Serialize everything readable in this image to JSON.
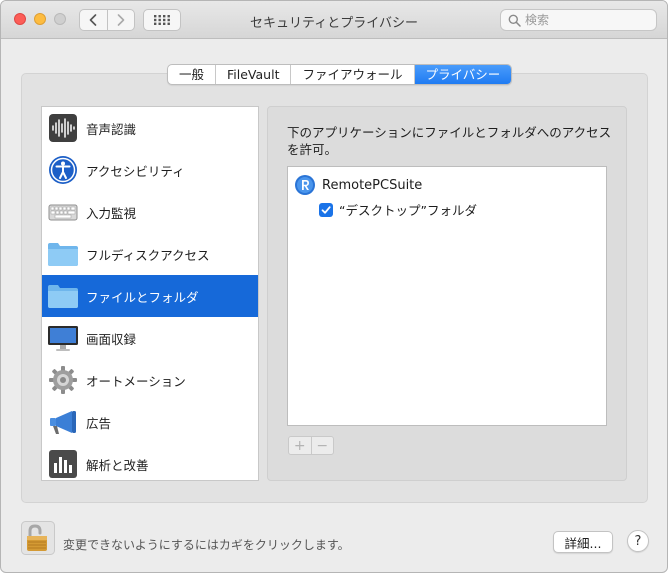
{
  "window": {
    "title": "セキュリティとプライバシー"
  },
  "toolbar": {
    "back_icon": "chevron-left-icon",
    "forward_icon": "chevron-right-icon",
    "grid_icon": "grid-icon"
  },
  "search": {
    "placeholder": "検索",
    "value": ""
  },
  "tabs": [
    {
      "label": "一般",
      "active": false
    },
    {
      "label": "FileVault",
      "active": false
    },
    {
      "label": "ファイアウォール",
      "active": false
    },
    {
      "label": "プライバシー",
      "active": true
    }
  ],
  "sidebar": {
    "items": [
      {
        "label": "音声認識",
        "icon": "speech-recognition-icon",
        "selected": false
      },
      {
        "label": "アクセシビリティ",
        "icon": "accessibility-icon",
        "selected": false
      },
      {
        "label": "入力監視",
        "icon": "keyboard-icon",
        "selected": false
      },
      {
        "label": "フルディスクアクセス",
        "icon": "folder-icon",
        "selected": false
      },
      {
        "label": "ファイルとフォルダ",
        "icon": "folder-icon",
        "selected": true
      },
      {
        "label": "画面収録",
        "icon": "display-icon",
        "selected": false
      },
      {
        "label": "オートメーション",
        "icon": "gear-icon",
        "selected": false
      },
      {
        "label": "広告",
        "icon": "megaphone-icon",
        "selected": false
      },
      {
        "label": "解析と改善",
        "icon": "bar-chart-icon",
        "selected": false
      }
    ]
  },
  "main": {
    "description": "下のアプリケーションにファイルとフォルダへのアクセスを許可。",
    "apps": [
      {
        "name": "RemotePCSuite",
        "icon": "remotepc-app-icon",
        "permissions": [
          {
            "label": "“デスクトップ”フォルダ",
            "checked": true
          }
        ]
      }
    ],
    "add_label": "+",
    "remove_label": "−"
  },
  "footer": {
    "lock_text": "変更できないようにするにはカギをクリックします。",
    "lock_icon": "unlocked-padlock-icon",
    "details_label": "詳細...",
    "help_label": "?"
  },
  "colors": {
    "accent": "#1669d9",
    "tab_active": "#1f7bf2",
    "checkbox": "#1a73e8"
  }
}
